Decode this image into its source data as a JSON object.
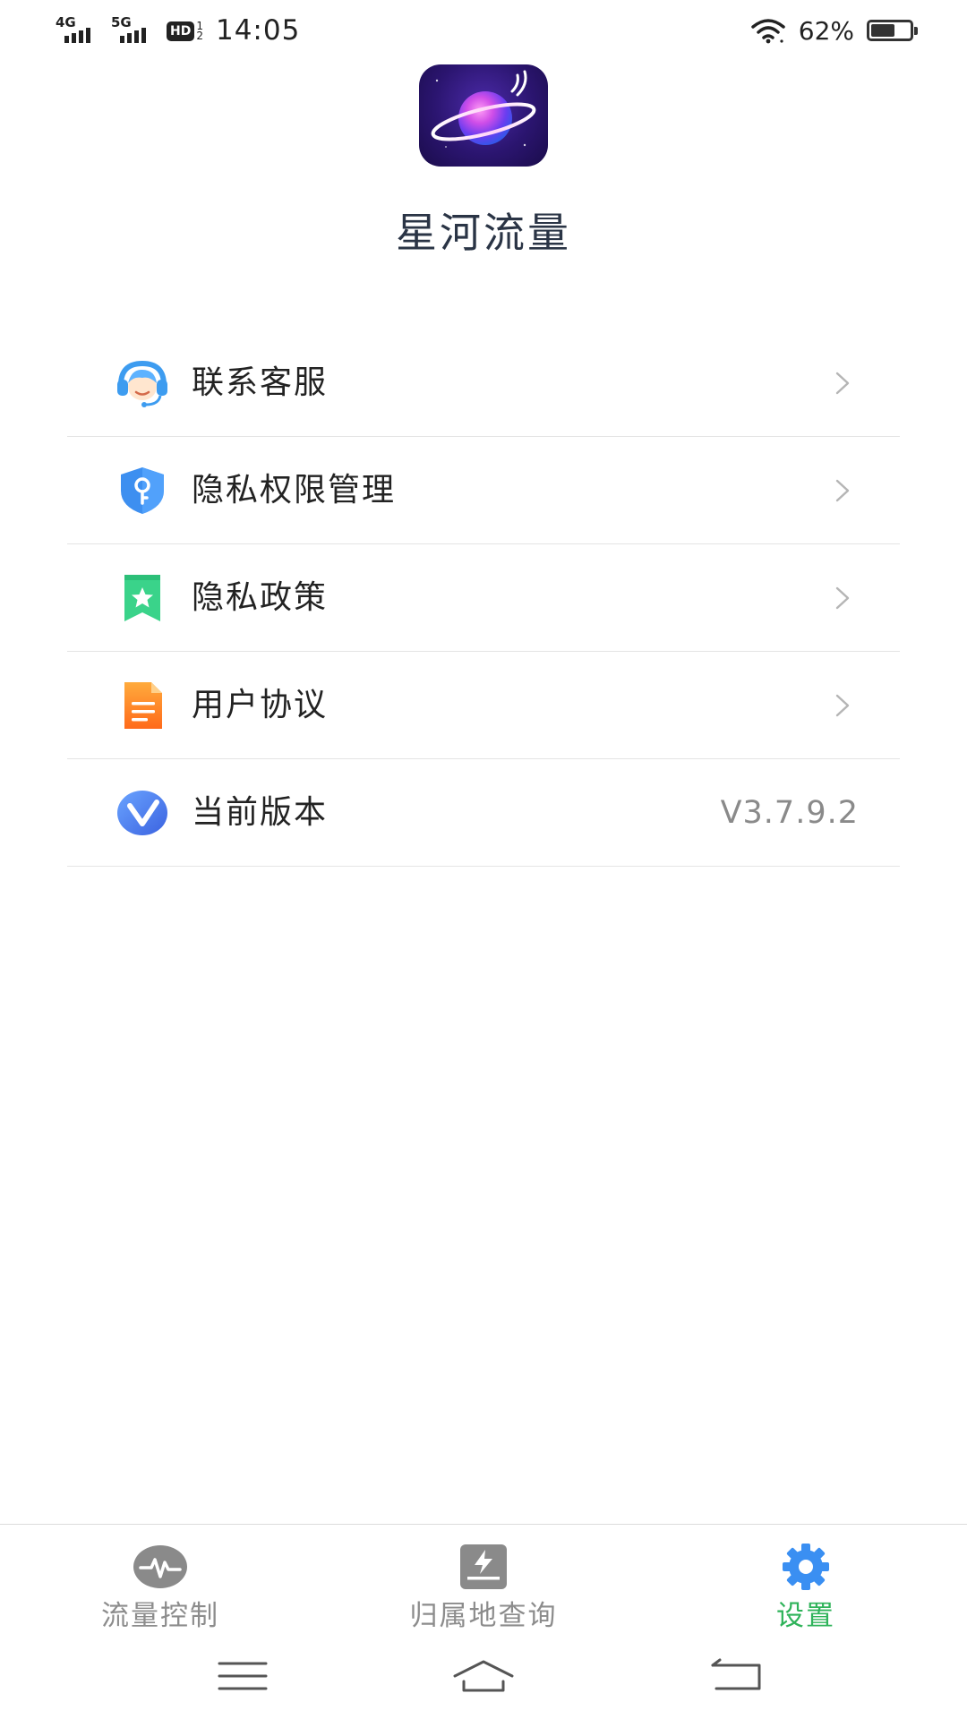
{
  "status_bar": {
    "signal1_label": "4G",
    "signal2_label": "5G",
    "hd_label": "HD",
    "hd_top": "1",
    "hd_bottom": "2",
    "time": "14:05",
    "battery_percent": "62%",
    "battery_level": 0.62,
    "icons": [
      "signal-4g-icon",
      "signal-5g-icon",
      "hd-voice-icon",
      "wifi-icon",
      "battery-icon"
    ]
  },
  "header": {
    "app_name": "星河流量",
    "logo_icon": "planet-logo-icon"
  },
  "menu": {
    "items": [
      {
        "label": "联系客服",
        "icon": "customer-service-icon",
        "icon_color": "#3d9cf0"
      },
      {
        "label": "隐私权限管理",
        "icon": "shield-key-icon",
        "icon_color": "#3d8ff0"
      },
      {
        "label": "隐私政策",
        "icon": "bookmark-star-icon",
        "icon_color": "#3ad38a"
      },
      {
        "label": "用户协议",
        "icon": "document-icon",
        "icon_color": "#ff8a1f"
      },
      {
        "label": "当前版本",
        "icon": "version-v-icon",
        "icon_color": "#4a7ef0",
        "value": "V3.7.9.2"
      }
    ]
  },
  "tab_bar": {
    "tabs": [
      {
        "label": "流量控制",
        "icon": "pulse-icon",
        "active": false
      },
      {
        "label": "归属地查询",
        "icon": "lightning-box-icon",
        "active": false
      },
      {
        "label": "设置",
        "icon": "gear-icon",
        "active": true
      }
    ],
    "active_color": "#2fb35a",
    "inactive_color": "#8c8c8c"
  },
  "nav_bar": {
    "buttons": [
      "menu-lines-icon",
      "home-icon",
      "back-icon"
    ]
  }
}
